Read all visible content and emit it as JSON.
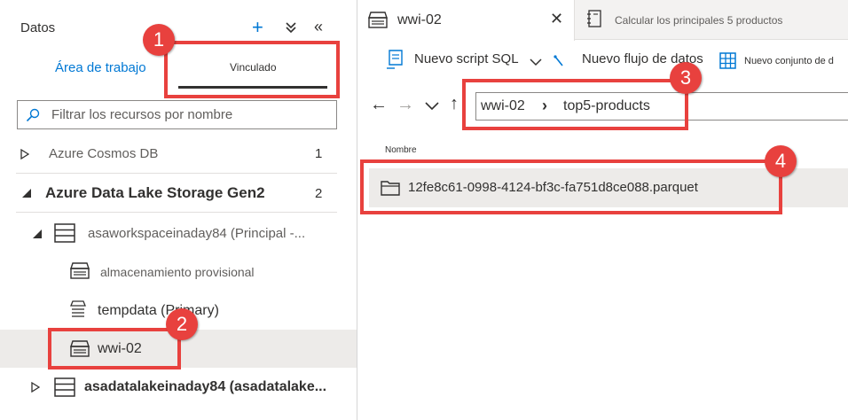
{
  "left": {
    "title": "Datos",
    "add_icon": "+",
    "collapse_all_icon": "⌄⌄",
    "hide_panel_icon": "«",
    "tabs": [
      {
        "label": "Área de trabajo",
        "active": false
      },
      {
        "label": "Vinculado",
        "active": true
      }
    ],
    "search": {
      "placeholder": "Filtrar los recursos por nombre",
      "value": ""
    },
    "tree": [
      {
        "label": "Azure Cosmos DB",
        "count": "1",
        "expanded": false
      },
      {
        "label": "Azure Data Lake Storage Gen2",
        "count": "2",
        "expanded": true
      },
      {
        "label": "asaworkspaceinaday84 (Principal -...",
        "expanded": true
      },
      {
        "label": "almacenamiento provisional"
      },
      {
        "label": "tempdata (Primary)"
      },
      {
        "label": "wwi-02",
        "selected": true
      },
      {
        "label": "asadatalakeinaday84 (asadatalake...",
        "expanded": false
      }
    ]
  },
  "right": {
    "tabs": [
      {
        "label": "wwi-02",
        "active": true,
        "close": "✕"
      },
      {
        "label": "Calcular los principales 5 productos",
        "active": false
      }
    ],
    "toolbar": {
      "new_sql_script": "Nuevo script SQL",
      "new_dataflow": "Nuevo flujo de datos",
      "new_dataset": "Nuevo conjunto de d"
    },
    "nav": {
      "back": "←",
      "forward": "→",
      "down": "⌄",
      "up": "↑"
    },
    "breadcrumb": [
      "wwi-02",
      "top5-products"
    ],
    "breadcrumb_sep": "›",
    "column_header": "Nombre",
    "files": [
      {
        "name": "12fe8c61-0998-4124-bf3c-fa751d8ce088.parquet"
      }
    ]
  },
  "callouts": [
    "1",
    "2",
    "3",
    "4"
  ],
  "colors": {
    "accent": "#0078d4",
    "callout": "#e8413e",
    "selected_bg": "#edebe9"
  }
}
